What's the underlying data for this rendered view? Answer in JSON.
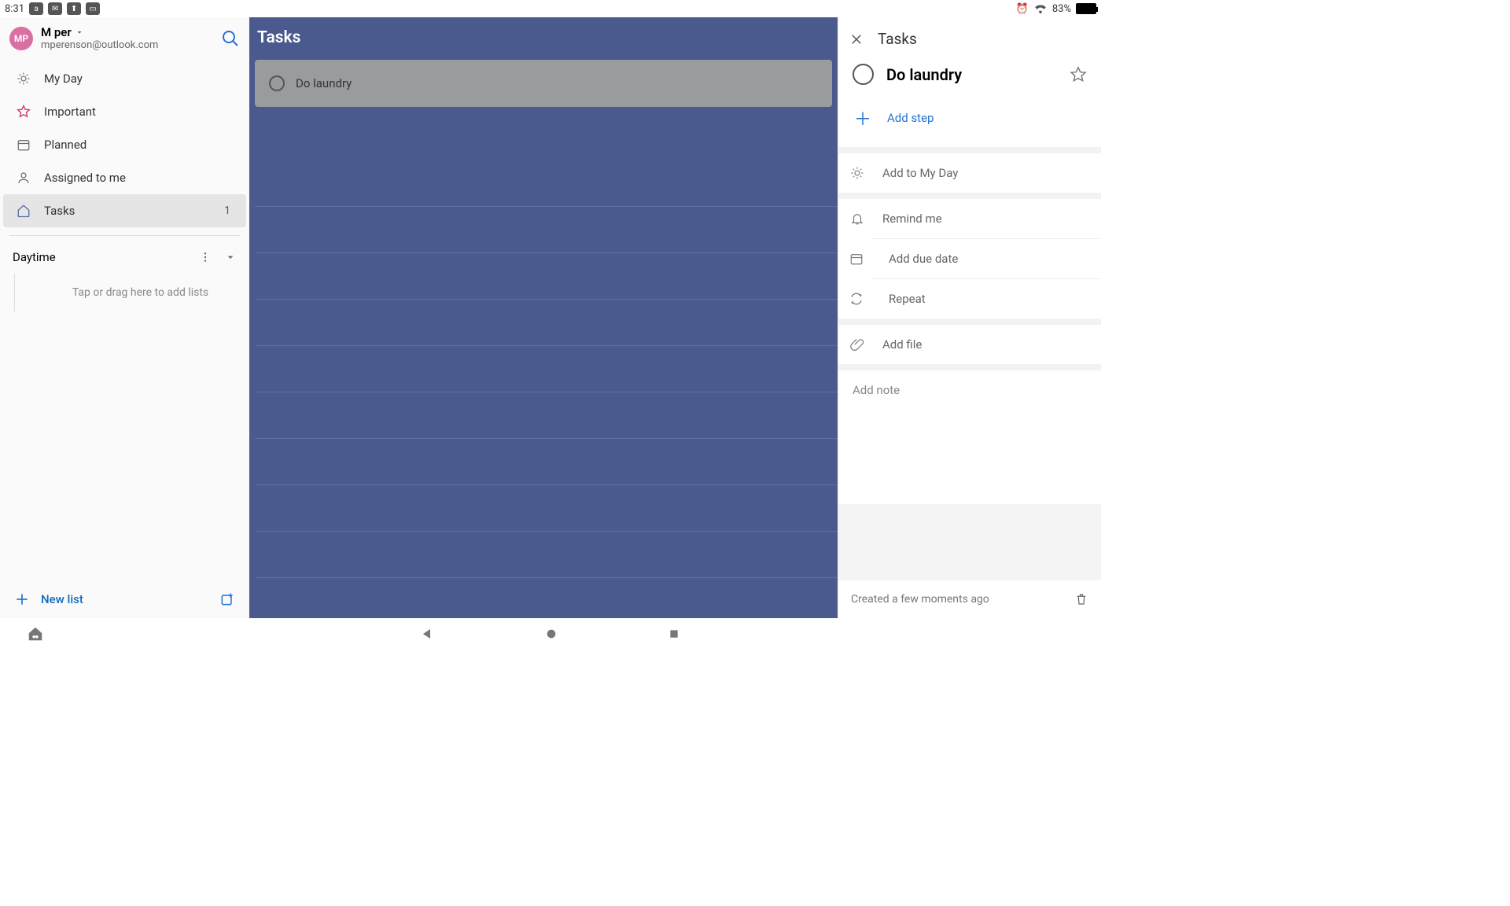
{
  "status": {
    "time": "8:31",
    "battery_pct": "83%"
  },
  "account": {
    "initials": "MP",
    "name": "M per",
    "email": "mperenson@outlook.com"
  },
  "sidebar": {
    "items": [
      {
        "label": "My Day"
      },
      {
        "label": "Important"
      },
      {
        "label": "Planned"
      },
      {
        "label": "Assigned to me"
      },
      {
        "label": "Tasks",
        "count": "1"
      }
    ],
    "group": {
      "name": "Daytime",
      "hint": "Tap or drag here to add lists"
    },
    "new_list": "New list"
  },
  "main": {
    "list_title": "Tasks",
    "tasks": [
      {
        "title": "Do laundry"
      }
    ]
  },
  "details": {
    "panel_title": "Tasks",
    "task_title": "Do laundry",
    "add_step": "Add step",
    "options": {
      "my_day": "Add to My Day",
      "remind": "Remind me",
      "due": "Add due date",
      "repeat": "Repeat",
      "file": "Add file"
    },
    "note_placeholder": "Add note",
    "created": "Created a few moments ago"
  }
}
